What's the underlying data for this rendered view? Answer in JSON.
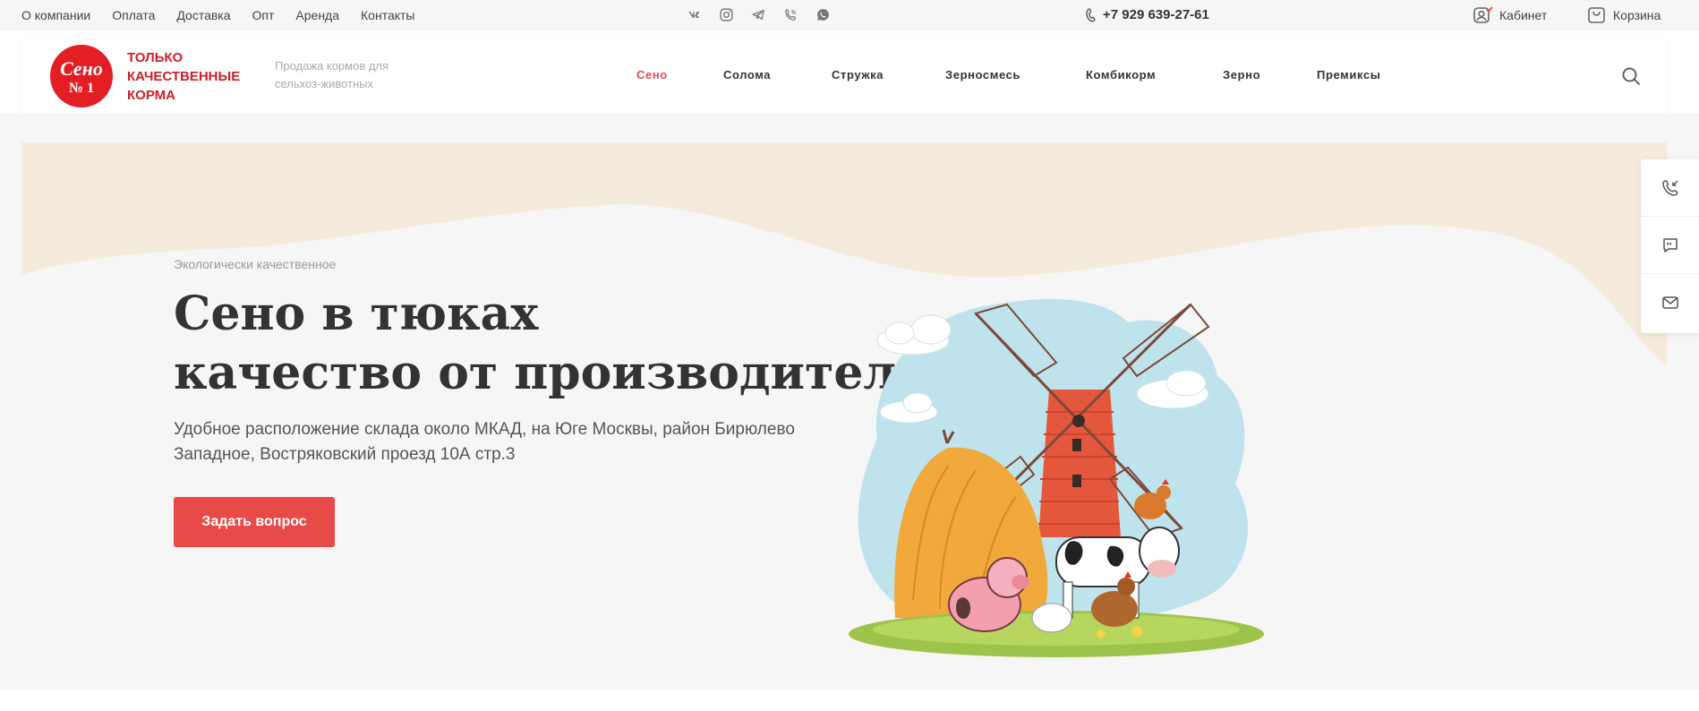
{
  "topnav": {
    "items": [
      "О компании",
      "Оплата",
      "Доставка",
      "Опт",
      "Аренда",
      "Контакты"
    ]
  },
  "socials": [
    "vk-icon",
    "instagram-icon",
    "telegram-icon",
    "viber-icon",
    "whatsapp-icon"
  ],
  "phone": "+7 929 639-27-61",
  "account": {
    "cabinet_label": "Кабинет",
    "cart_label": "Корзина"
  },
  "logo": {
    "line1": "Сено",
    "line2": "№ 1"
  },
  "slogan": "Только качественные корма",
  "tagline": "Продажа кормов для сельхоз-животных",
  "mainnav": {
    "items": [
      "Сено",
      "Солома",
      "Стружка",
      "Зерносмесь",
      "Комбикорм",
      "Зерно",
      "Премиксы"
    ],
    "active": "Сено"
  },
  "hero": {
    "eyebrow": "Экологически качественное",
    "title_line1": "Сено в тюках",
    "title_line2": "качество от производителя",
    "description": "Удобное расположение склада около МКАД, на Юге Москвы, район Бирюлево Западное, Востряковский проезд 10А стр.3",
    "button_label": "Задать вопрос"
  },
  "side_widget": [
    "callback-icon",
    "chat-icon",
    "mail-icon"
  ],
  "colors": {
    "accent": "#e84a4a",
    "brand": "#e31e24",
    "hero_bg": "#f6f6f6",
    "wave": "#f4ebdc"
  }
}
